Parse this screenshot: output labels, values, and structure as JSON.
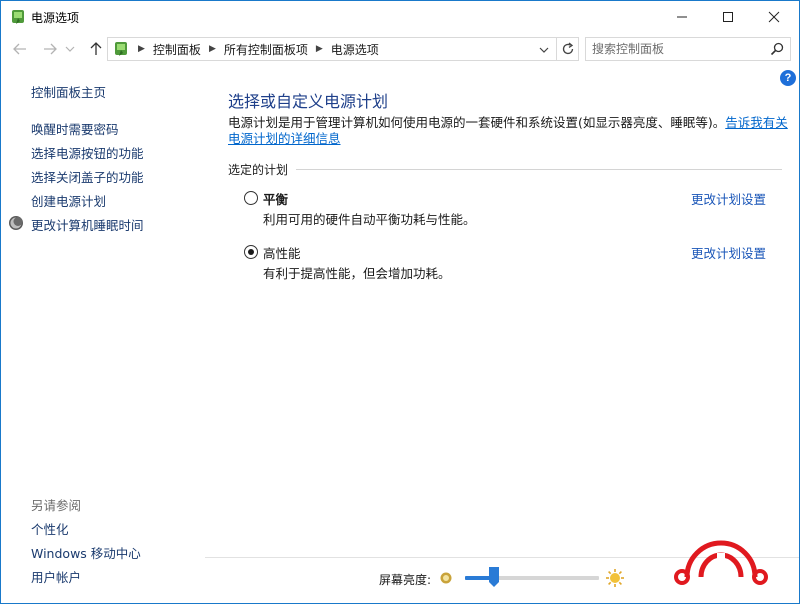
{
  "window": {
    "title": "电源选项",
    "minimize_label": "—",
    "maximize_label": "☐",
    "close_label": "✕"
  },
  "address_bar": {
    "breadcrumbs": [
      "控制面板",
      "所有控制面板项",
      "电源选项"
    ],
    "search_placeholder": "搜索控制面板"
  },
  "sidebar": {
    "home": "控制面板主页",
    "links": [
      "唤醒时需要密码",
      "选择电源按钮的功能",
      "选择关闭盖子的功能",
      "创建电源计划",
      "更改计算机睡眠时间"
    ],
    "see_also_label": "另请参阅",
    "see_also": [
      "个性化",
      "Windows 移动中心",
      "用户帐户"
    ]
  },
  "main": {
    "title": "选择或自定义电源计划",
    "description": "电源计划是用于管理计算机如何使用电源的一套硬件和系统设置(如显示器亮度、睡眠等)。",
    "description_link": "告诉我有关电源计划的详细信息",
    "section_label": "选定的计划",
    "plans": [
      {
        "name": "平衡",
        "description": "利用可用的硬件自动平衡功耗与性能。",
        "link": "更改计划设置",
        "selected": false
      },
      {
        "name": "高性能",
        "description": "有利于提高性能，但会增加功耗。",
        "link": "更改计划设置",
        "selected": true
      }
    ]
  },
  "brightness": {
    "label": "屏幕亮度:",
    "level_fraction": 0.22
  },
  "colors": {
    "accent": "#1e3f8a",
    "link": "#1a56b8",
    "slider": "#2a7bd6",
    "logo_red": "#e0191f"
  }
}
